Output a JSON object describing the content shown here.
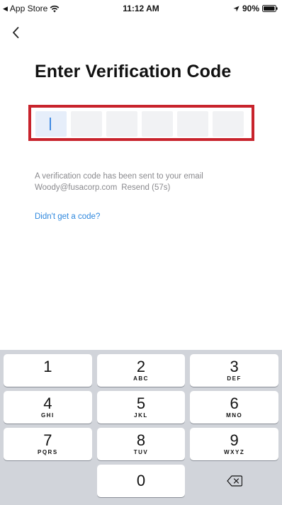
{
  "status_bar": {
    "carrier_back": "App Store",
    "time": "11:12 AM",
    "battery": "90%"
  },
  "title": "Enter Verification Code",
  "code": {
    "length": 6,
    "digits": [
      "",
      "",
      "",
      "",
      "",
      ""
    ]
  },
  "info": {
    "line1": "A verification code has been sent to your email",
    "email": "Woody@fusacorp.com",
    "resend": "Resend (57s)"
  },
  "no_code_link": "Didn't get a code?",
  "keypad": {
    "keys": [
      {
        "digit": "1",
        "letters": ""
      },
      {
        "digit": "2",
        "letters": "ABC"
      },
      {
        "digit": "3",
        "letters": "DEF"
      },
      {
        "digit": "4",
        "letters": "GHI"
      },
      {
        "digit": "5",
        "letters": "JKL"
      },
      {
        "digit": "6",
        "letters": "MNO"
      },
      {
        "digit": "7",
        "letters": "PQRS"
      },
      {
        "digit": "8",
        "letters": "TUV"
      },
      {
        "digit": "9",
        "letters": "WXYZ"
      },
      {
        "digit": "0",
        "letters": ""
      }
    ]
  },
  "colors": {
    "highlight_border": "#c8232c",
    "link": "#2f88de",
    "cursor": "#3f8ae3",
    "keypad_bg": "#d1d4da"
  },
  "icons": {
    "back": "chevron-left-icon",
    "wifi": "wifi-icon",
    "location": "location-arrow-icon",
    "battery": "battery-icon",
    "delete": "backspace-icon"
  }
}
